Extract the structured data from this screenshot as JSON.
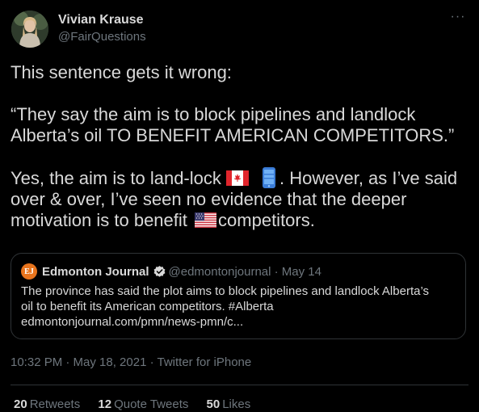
{
  "author": {
    "display_name": "Vivian Krause",
    "handle": "@FairQuestions"
  },
  "tweet": {
    "line1": "This sentence gets it wrong:",
    "quote_line": "“They say the aim is to block pipelines and landlock Alberta’s oil TO BENEFIT AMERICAN COMPETITORS.”",
    "part_a": "Yes, the aim is to land-lock",
    "part_b": ". However, as I’ve said over & over, I’ve seen no evidence that the deeper motivation is to benefit",
    "part_c": "competitors."
  },
  "quoted_tweet": {
    "logo_text": "EJ",
    "name": "Edmonton Journal",
    "handle_date": "@edmontonjournal · May 14",
    "body_line1": "The province has said the plot aims to block pipelines and landlock Alberta’s",
    "body_line2": "oil to benefit its American competitors. #Alberta",
    "body_line3": "edmontonjournal.com/pmn/news-pmn/c..."
  },
  "meta": {
    "time_date": "10:32 PM · May 18, 2021 · ",
    "source": "Twitter for iPhone"
  },
  "stats": {
    "retweets_count": "20",
    "retweets_label": "Retweets",
    "quotes_count": "12",
    "quotes_label": "Quote Tweets",
    "likes_count": "50",
    "likes_label": "Likes"
  },
  "icons": {
    "more": "more-horizontal-icon",
    "verified": "verified-badge-icon",
    "flag_ca": "canada-flag-icon",
    "phone": "mobile-phone-icon",
    "flag_us": "usa-flag-icon"
  },
  "colors": {
    "background": "#000000",
    "text": "#d9d9d9",
    "muted": "#6e767d",
    "border": "#2f3336",
    "link_blue": "#1d9bf0",
    "ej_orange": "#e8741d"
  }
}
